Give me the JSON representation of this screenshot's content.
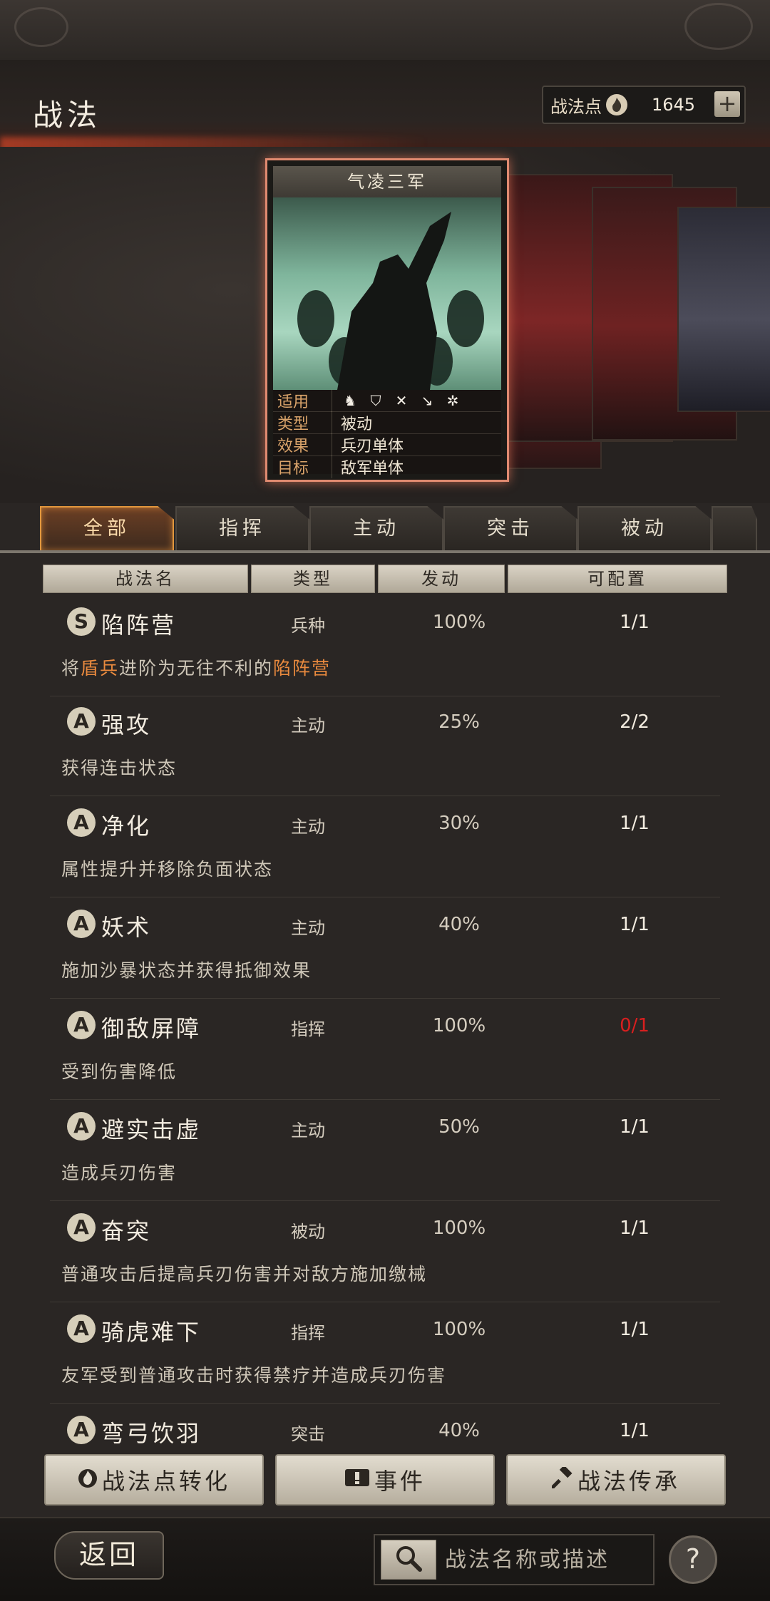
{
  "header": {
    "title": "战法",
    "points_label": "战法点",
    "points_value": "1645",
    "plus_label": "+"
  },
  "card": {
    "title": "气凌三军",
    "rows": [
      {
        "key": "适用",
        "value": ""
      },
      {
        "key": "类型",
        "value": "被动"
      },
      {
        "key": "效果",
        "value": "兵刃单体"
      },
      {
        "key": "目标",
        "value": "敌军单体"
      }
    ],
    "troop_icons": [
      "cavalry-icon",
      "shield-icon",
      "bow-icon",
      "spear-icon",
      "siege-icon"
    ]
  },
  "tabs": [
    {
      "label": "全部",
      "active": true
    },
    {
      "label": "指挥",
      "active": false
    },
    {
      "label": "主动",
      "active": false
    },
    {
      "label": "突击",
      "active": false
    },
    {
      "label": "被动",
      "active": false
    }
  ],
  "columns": [
    "战法名",
    "类型",
    "发动",
    "可配置"
  ],
  "skills": [
    {
      "grade": "S",
      "name": "陷阵营",
      "type": "兵种",
      "rate": "100%",
      "config": "1/1",
      "desc_parts": [
        "将",
        "盾兵",
        "进阶为无往不利的",
        "陷阵营",
        ""
      ]
    },
    {
      "grade": "A",
      "name": "强攻",
      "type": "主动",
      "rate": "25%",
      "config": "2/2",
      "desc": "获得连击状态"
    },
    {
      "grade": "A",
      "name": "净化",
      "type": "主动",
      "rate": "30%",
      "config": "1/1",
      "desc": "属性提升并移除负面状态"
    },
    {
      "grade": "A",
      "name": "妖术",
      "type": "主动",
      "rate": "40%",
      "config": "1/1",
      "desc": "施加沙暴状态并获得抵御效果"
    },
    {
      "grade": "A",
      "name": "御敌屏障",
      "type": "指挥",
      "rate": "100%",
      "config": "0/1",
      "desc": "受到伤害降低"
    },
    {
      "grade": "A",
      "name": "避实击虚",
      "type": "主动",
      "rate": "50%",
      "config": "1/1",
      "desc": "造成兵刃伤害"
    },
    {
      "grade": "A",
      "name": "奋突",
      "type": "被动",
      "rate": "100%",
      "config": "1/1",
      "desc": "普通攻击后提高兵刃伤害并对敌方施加缴械"
    },
    {
      "grade": "A",
      "name": "骑虎难下",
      "type": "指挥",
      "rate": "100%",
      "config": "1/1",
      "desc": "友军受到普通攻击时获得禁疗并造成兵刃伤害"
    },
    {
      "grade": "A",
      "name": "弯弓饮羽",
      "type": "突击",
      "rate": "40%",
      "config": "1/1",
      "desc": ""
    }
  ],
  "bottom_buttons": {
    "convert": "战法点转化",
    "events": "事件",
    "inherit": "战法传承"
  },
  "footer": {
    "back": "返回",
    "search_placeholder": "战法名称或描述",
    "help": "?"
  },
  "colors": {
    "accent": "#e2973d",
    "highlight": "#ea8a3e",
    "warning": "#d81f1f",
    "card_border": "#e08a70"
  }
}
